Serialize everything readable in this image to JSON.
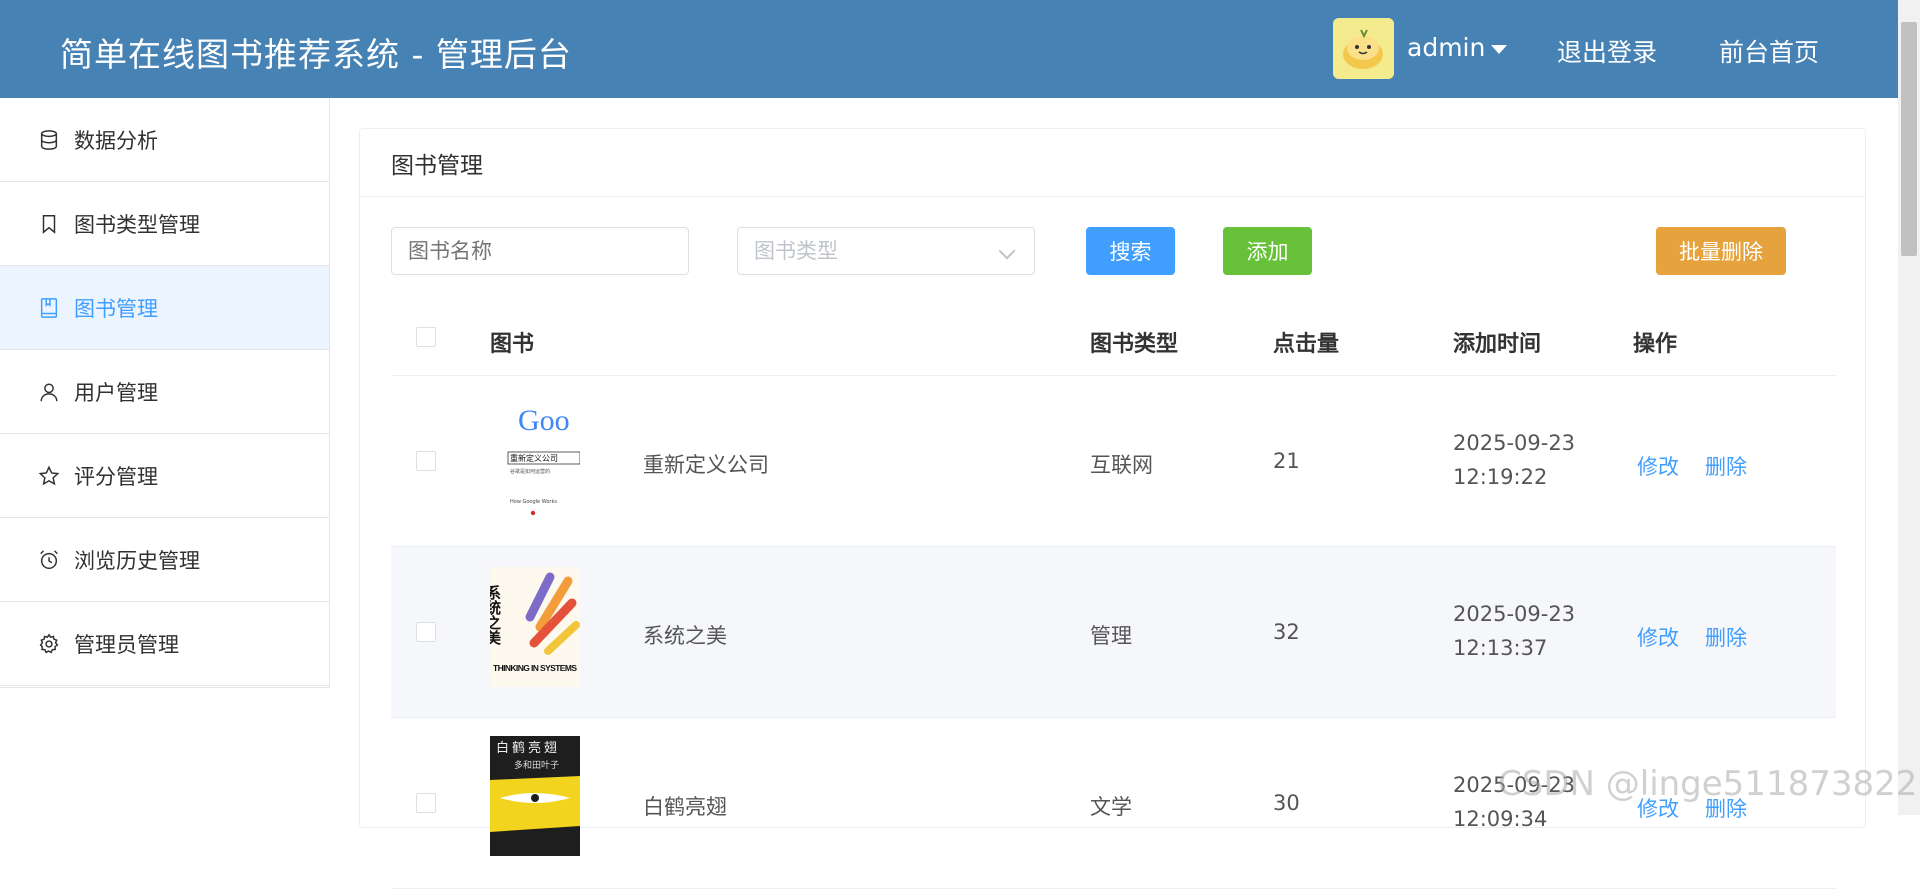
{
  "header": {
    "title": "简单在线图书推荐系统 - 管理后台",
    "username": "admin",
    "logout": "退出登录",
    "frontend": "前台首页"
  },
  "sidebar": {
    "items": [
      {
        "label": "数据分析",
        "icon": "database-icon"
      },
      {
        "label": "图书类型管理",
        "icon": "bookmark-icon"
      },
      {
        "label": "图书管理",
        "icon": "book-icon",
        "active": true
      },
      {
        "label": "用户管理",
        "icon": "user-icon"
      },
      {
        "label": "评分管理",
        "icon": "star-icon"
      },
      {
        "label": "浏览历史管理",
        "icon": "alarm-clock-icon"
      },
      {
        "label": "管理员管理",
        "icon": "gear-icon"
      }
    ]
  },
  "card": {
    "title": "图书管理"
  },
  "toolbar": {
    "name_placeholder": "图书名称",
    "type_placeholder": "图书类型",
    "search": "搜索",
    "add": "添加",
    "batch_delete": "批量删除"
  },
  "table": {
    "columns": {
      "book": "图书",
      "type": "图书类型",
      "clicks": "点击量",
      "time": "添加时间",
      "ops": "操作"
    },
    "rows": [
      {
        "name": "重新定义公司",
        "type": "互联网",
        "clicks": "21",
        "date": "2025-09-23",
        "time": "12:19:22",
        "edit": "修改",
        "delete": "删除",
        "cover_logo": "Goo",
        "cover_title": "重新定义公司",
        "cover_sub": "谷歌是如何运营的",
        "cover_en": "How Google Works"
      },
      {
        "name": "系统之美",
        "type": "管理",
        "clicks": "32",
        "date": "2025-09-23",
        "time": "12:13:37",
        "edit": "修改",
        "delete": "删除",
        "cover_title": "系统之美",
        "cover_en": "THINKING IN SYSTEMS"
      },
      {
        "name": "白鹤亮翅",
        "type": "文学",
        "clicks": "30",
        "date": "2025-09-23",
        "time": "12:09:34",
        "edit": "修改",
        "delete": "删除",
        "cover_title": "白鹤亮翅",
        "cover_sub": "多和田叶子"
      }
    ]
  },
  "watermark": "CSDN @linge511873822",
  "colors": {
    "header": "#4682b4",
    "primary": "#409eff",
    "success": "#67c23a",
    "warning": "#e6a23c"
  }
}
